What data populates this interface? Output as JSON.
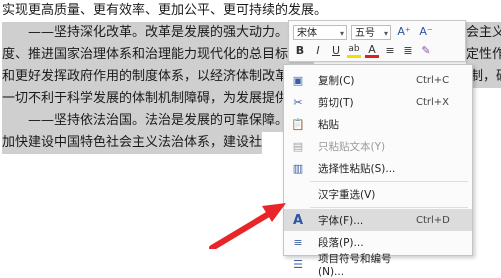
{
  "document": {
    "lines": [
      "实现更高质量、更有效率、更加公平、更可持续的发展。",
      "　　——坚持深化改革。改革是发展的强大动力。必须",
      "度、推进国家治理体系和治理能力现代化的总目标，健",
      "和更好发挥政府作用的制度体系，以经济体制改革为重点，加快完善各方面体制机制，破除",
      "一切不利于科学发展的体制机制障碍，为发展提供持续",
      "　　——坚持依法治国。法治是发展的可靠保障。必须坚定",
      "加快建设中国特色社会主义法治体系，建设社"
    ],
    "right_fragments": [
      "会主义制",
      "定性作用"
    ]
  },
  "mini_toolbar": {
    "font_name": "宋体",
    "font_size": "五号",
    "grow_font_icon": "A⁺",
    "shrink_font_icon": "A⁻",
    "bold": "B",
    "italic": "I",
    "underline": "U",
    "highlight": "ab",
    "font_color": "A",
    "align_center": "≡",
    "list": "≣",
    "format_painter": "✎"
  },
  "context_menu": {
    "items": [
      {
        "label": "复制(C)",
        "shortcut": "Ctrl+C",
        "icon": "copy-icon",
        "glyph": "▣",
        "disabled": false
      },
      {
        "label": "剪切(T)",
        "shortcut": "Ctrl+X",
        "icon": "scissors-icon",
        "glyph": "✂",
        "disabled": false
      },
      {
        "label": "粘贴",
        "shortcut": "",
        "icon": "paste-icon",
        "glyph": "📋",
        "disabled": false
      },
      {
        "label": "只粘贴文本(Y)",
        "shortcut": "",
        "icon": "paste-text-icon",
        "glyph": "▤",
        "disabled": true
      },
      {
        "label": "选择性粘贴(S)...",
        "shortcut": "",
        "icon": "paste-special-icon",
        "glyph": "▥",
        "disabled": false
      },
      {
        "label": "汉字重选(V)",
        "shortcut": "",
        "icon": "",
        "glyph": "",
        "disabled": false
      },
      {
        "label": "字体(F)...",
        "shortcut": "Ctrl+D",
        "icon": "font-icon",
        "glyph": "A",
        "disabled": false
      },
      {
        "label": "段落(P)...",
        "shortcut": "",
        "icon": "paragraph-icon",
        "glyph": "≡",
        "disabled": false
      },
      {
        "label": "项目符号和编号(N)...",
        "shortcut": "",
        "icon": "bullet-list-icon",
        "glyph": "☰",
        "disabled": false
      }
    ]
  },
  "colors": {
    "selection": "#cfcfcf",
    "arrow": "#e8262a",
    "menu_highlight": "#dcdcdc"
  }
}
